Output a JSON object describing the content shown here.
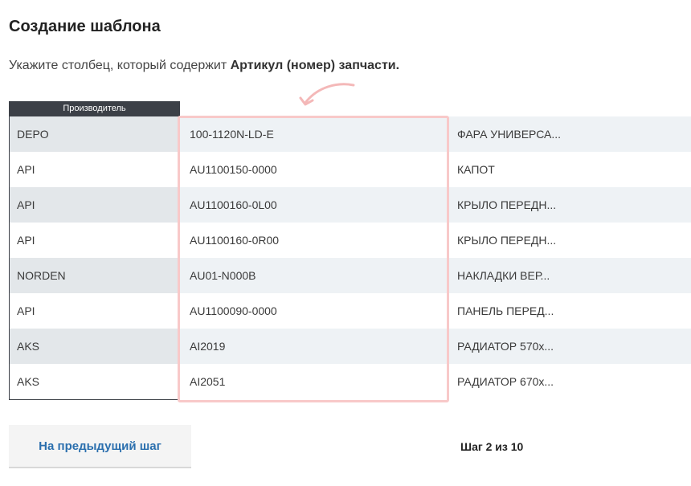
{
  "header": {
    "title": "Создание шаблона",
    "instruction_prefix": "Укажите столбец, который содержит ",
    "instruction_bold": "Артикул (номер) запчасти."
  },
  "table": {
    "column_header": "Производитель",
    "rows": [
      {
        "manufacturer": "DEPO",
        "article": "100-1120N-LD-E",
        "description": "ФАРА УНИВЕРСА..."
      },
      {
        "manufacturer": "API",
        "article": "AU1100150-0000",
        "description": "КАПОТ"
      },
      {
        "manufacturer": "API",
        "article": "AU1100160-0L00",
        "description": "КРЫЛО ПЕРЕДН..."
      },
      {
        "manufacturer": "API",
        "article": "AU1100160-0R00",
        "description": "КРЫЛО ПЕРЕДН..."
      },
      {
        "manufacturer": "NORDEN",
        "article": "AU01-N000B",
        "description": "НАКЛАДКИ ВЕР..."
      },
      {
        "manufacturer": "API",
        "article": "AU1100090-0000",
        "description": "ПАНЕЛЬ ПЕРЕД..."
      },
      {
        "manufacturer": "AKS",
        "article": "AI2019",
        "description": "РАДИАТОР 570х..."
      },
      {
        "manufacturer": "AKS",
        "article": "AI2051",
        "description": "РАДИАТОР 670х..."
      }
    ]
  },
  "footer": {
    "prev_label": "На предыдущий шаг",
    "step_text": "Шаг 2 из 10"
  },
  "colors": {
    "header_bg": "#3c4047",
    "highlight": "#f8c9c9",
    "link_blue": "#2b6fae"
  },
  "icons": {
    "arrow": "curved-arrow-icon"
  }
}
